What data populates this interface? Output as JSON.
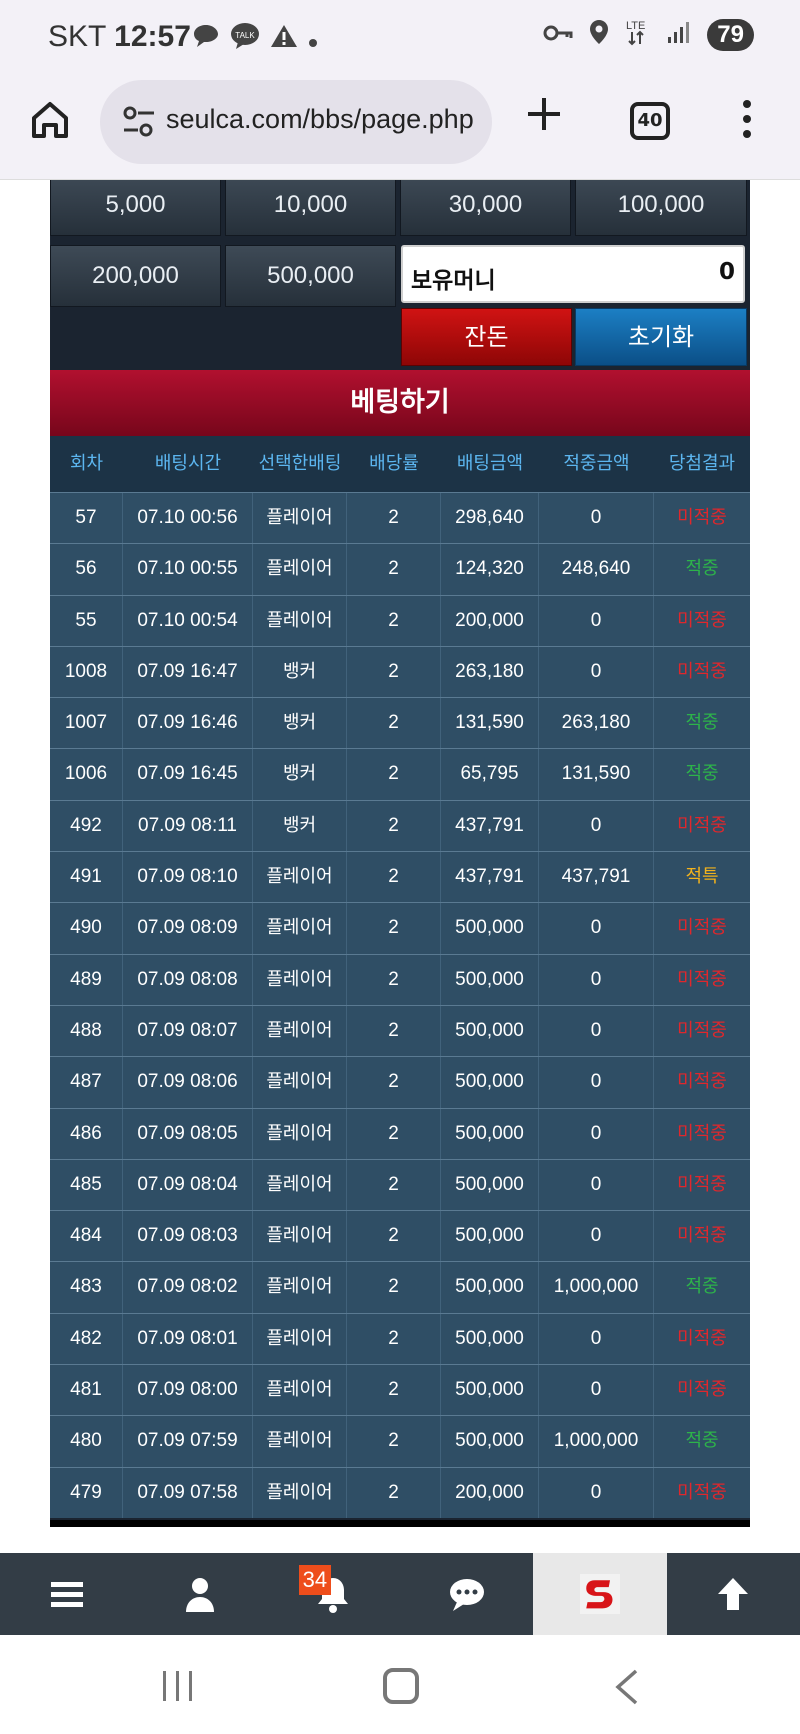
{
  "status_bar": {
    "carrier": "SKT",
    "time": "12:57",
    "notif_talk": "TALK",
    "network": "LTE",
    "battery": "79"
  },
  "browser": {
    "url": "seulca.com/bbs/page.php",
    "tab_count": "40"
  },
  "chips": [
    "5,000",
    "10,000",
    "30,000",
    "100,000",
    "200,000",
    "500,000"
  ],
  "money": {
    "label": "보유머니",
    "value": "0"
  },
  "buttons": {
    "balance": "잔돈",
    "reset": "초기화"
  },
  "bet_header": "베팅하기",
  "table": {
    "headers": [
      "회차",
      "배팅시간",
      "선택한배팅",
      "배당률",
      "배팅금액",
      "적중금액",
      "당첨결과"
    ],
    "rows": [
      {
        "round": "57",
        "time": "07.10 00:56",
        "pick": "플레이어",
        "odds": "2",
        "amount": "298,640",
        "payout": "0",
        "result": "미적중",
        "status": "lose"
      },
      {
        "round": "56",
        "time": "07.10 00:55",
        "pick": "플레이어",
        "odds": "2",
        "amount": "124,320",
        "payout": "248,640",
        "result": "적중",
        "status": "win"
      },
      {
        "round": "55",
        "time": "07.10 00:54",
        "pick": "플레이어",
        "odds": "2",
        "amount": "200,000",
        "payout": "0",
        "result": "미적중",
        "status": "lose"
      },
      {
        "round": "1008",
        "time": "07.09 16:47",
        "pick": "뱅커",
        "odds": "2",
        "amount": "263,180",
        "payout": "0",
        "result": "미적중",
        "status": "lose"
      },
      {
        "round": "1007",
        "time": "07.09 16:46",
        "pick": "뱅커",
        "odds": "2",
        "amount": "131,590",
        "payout": "263,180",
        "result": "적중",
        "status": "win"
      },
      {
        "round": "1006",
        "time": "07.09 16:45",
        "pick": "뱅커",
        "odds": "2",
        "amount": "65,795",
        "payout": "131,590",
        "result": "적중",
        "status": "win"
      },
      {
        "round": "492",
        "time": "07.09 08:11",
        "pick": "뱅커",
        "odds": "2",
        "amount": "437,791",
        "payout": "0",
        "result": "미적중",
        "status": "lose"
      },
      {
        "round": "491",
        "time": "07.09 08:10",
        "pick": "플레이어",
        "odds": "2",
        "amount": "437,791",
        "payout": "437,791",
        "result": "적특",
        "status": "special"
      },
      {
        "round": "490",
        "time": "07.09 08:09",
        "pick": "플레이어",
        "odds": "2",
        "amount": "500,000",
        "payout": "0",
        "result": "미적중",
        "status": "lose"
      },
      {
        "round": "489",
        "time": "07.09 08:08",
        "pick": "플레이어",
        "odds": "2",
        "amount": "500,000",
        "payout": "0",
        "result": "미적중",
        "status": "lose"
      },
      {
        "round": "488",
        "time": "07.09 08:07",
        "pick": "플레이어",
        "odds": "2",
        "amount": "500,000",
        "payout": "0",
        "result": "미적중",
        "status": "lose"
      },
      {
        "round": "487",
        "time": "07.09 08:06",
        "pick": "플레이어",
        "odds": "2",
        "amount": "500,000",
        "payout": "0",
        "result": "미적중",
        "status": "lose"
      },
      {
        "round": "486",
        "time": "07.09 08:05",
        "pick": "플레이어",
        "odds": "2",
        "amount": "500,000",
        "payout": "0",
        "result": "미적중",
        "status": "lose"
      },
      {
        "round": "485",
        "time": "07.09 08:04",
        "pick": "플레이어",
        "odds": "2",
        "amount": "500,000",
        "payout": "0",
        "result": "미적중",
        "status": "lose"
      },
      {
        "round": "484",
        "time": "07.09 08:03",
        "pick": "플레이어",
        "odds": "2",
        "amount": "500,000",
        "payout": "0",
        "result": "미적중",
        "status": "lose"
      },
      {
        "round": "483",
        "time": "07.09 08:02",
        "pick": "플레이어",
        "odds": "2",
        "amount": "500,000",
        "payout": "1,000,000",
        "result": "적중",
        "status": "win"
      },
      {
        "round": "482",
        "time": "07.09 08:01",
        "pick": "플레이어",
        "odds": "2",
        "amount": "500,000",
        "payout": "0",
        "result": "미적중",
        "status": "lose"
      },
      {
        "round": "481",
        "time": "07.09 08:00",
        "pick": "플레이어",
        "odds": "2",
        "amount": "500,000",
        "payout": "0",
        "result": "미적중",
        "status": "lose"
      },
      {
        "round": "480",
        "time": "07.09 07:59",
        "pick": "플레이어",
        "odds": "2",
        "amount": "500,000",
        "payout": "1,000,000",
        "result": "적중",
        "status": "win"
      },
      {
        "round": "479",
        "time": "07.09 07:58",
        "pick": "플레이어",
        "odds": "2",
        "amount": "200,000",
        "payout": "0",
        "result": "미적중",
        "status": "lose"
      }
    ]
  },
  "bottom_nav": {
    "items": [
      "menu-icon",
      "user-icon",
      "bell-icon",
      "chat-icon",
      "site-logo",
      "arrow-up-icon"
    ],
    "notification_count": "34"
  },
  "colors": {
    "panel_bg": "#1b2430",
    "row_bg": "#2f4e65",
    "header_text": "#5cb6f0",
    "lose": "#e0272c",
    "win": "#2db34a",
    "special": "#f2b21c",
    "bet_header": "#a30c28"
  }
}
